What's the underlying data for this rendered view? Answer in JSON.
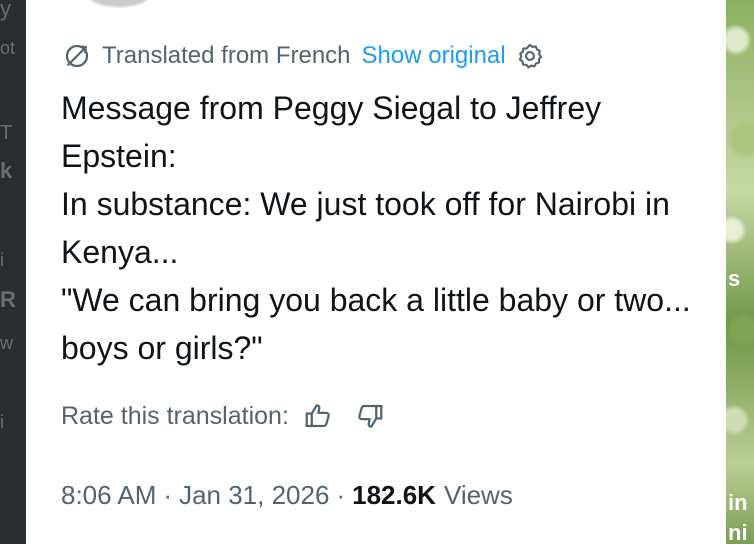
{
  "translation": {
    "translated_label": "Translated from French",
    "show_original_label": "Show original",
    "icon": "translate-icon",
    "settings_icon": "gear-icon"
  },
  "tweet": {
    "lines": [
      "Message from Peggy Siegal to Jeffrey Epstein:",
      "In substance: We just took off for Nairobi in Kenya...",
      "\"We can bring you back a little baby or two... boys or girls?\""
    ]
  },
  "rating": {
    "label": "Rate this translation:",
    "thumbs_up_icon": "thumbs-up-icon",
    "thumbs_down_icon": "thumbs-down-icon"
  },
  "meta": {
    "time": "8:06 AM",
    "date": "Jan 31, 2026",
    "separator": "·",
    "views_count": "182.6K",
    "views_label": "Views"
  },
  "colors": {
    "text_primary": "#0f1419",
    "text_secondary": "#536471",
    "link": "#1d9bf0"
  }
}
